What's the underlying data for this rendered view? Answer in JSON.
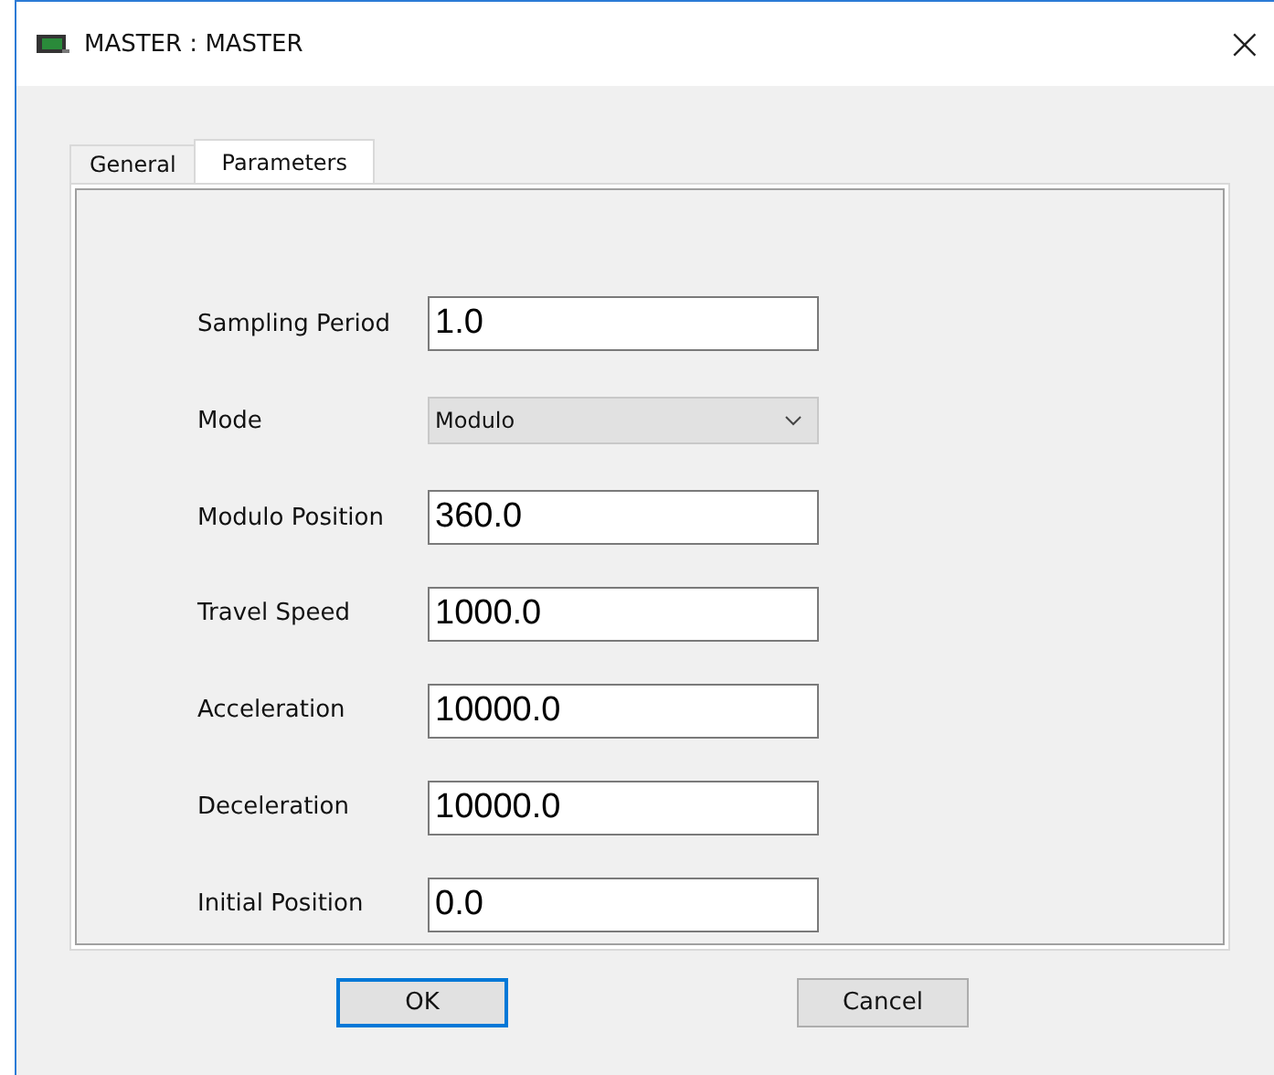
{
  "window": {
    "title": "MASTER : MASTER",
    "close": "×"
  },
  "tabs": [
    {
      "label": "General",
      "selected": false
    },
    {
      "label": "Parameters",
      "selected": true
    }
  ],
  "fields": [
    {
      "kind": "text",
      "label": "Sampling Period",
      "value": "1.0"
    },
    {
      "kind": "dropdown",
      "label": "Mode",
      "value": "Modulo"
    },
    {
      "kind": "text",
      "label": "Modulo Position",
      "value": "360.0"
    },
    {
      "kind": "text",
      "label": "Travel Speed",
      "value": "1000.0"
    },
    {
      "kind": "text",
      "label": "Acceleration",
      "value": "10000.0"
    },
    {
      "kind": "text",
      "label": "Deceleration",
      "value": "10000.0"
    },
    {
      "kind": "text",
      "label": "Initial Position",
      "value": "0.0"
    }
  ],
  "buttons": [
    {
      "label": "OK",
      "default": true
    },
    {
      "label": "Cancel",
      "default": false
    }
  ]
}
